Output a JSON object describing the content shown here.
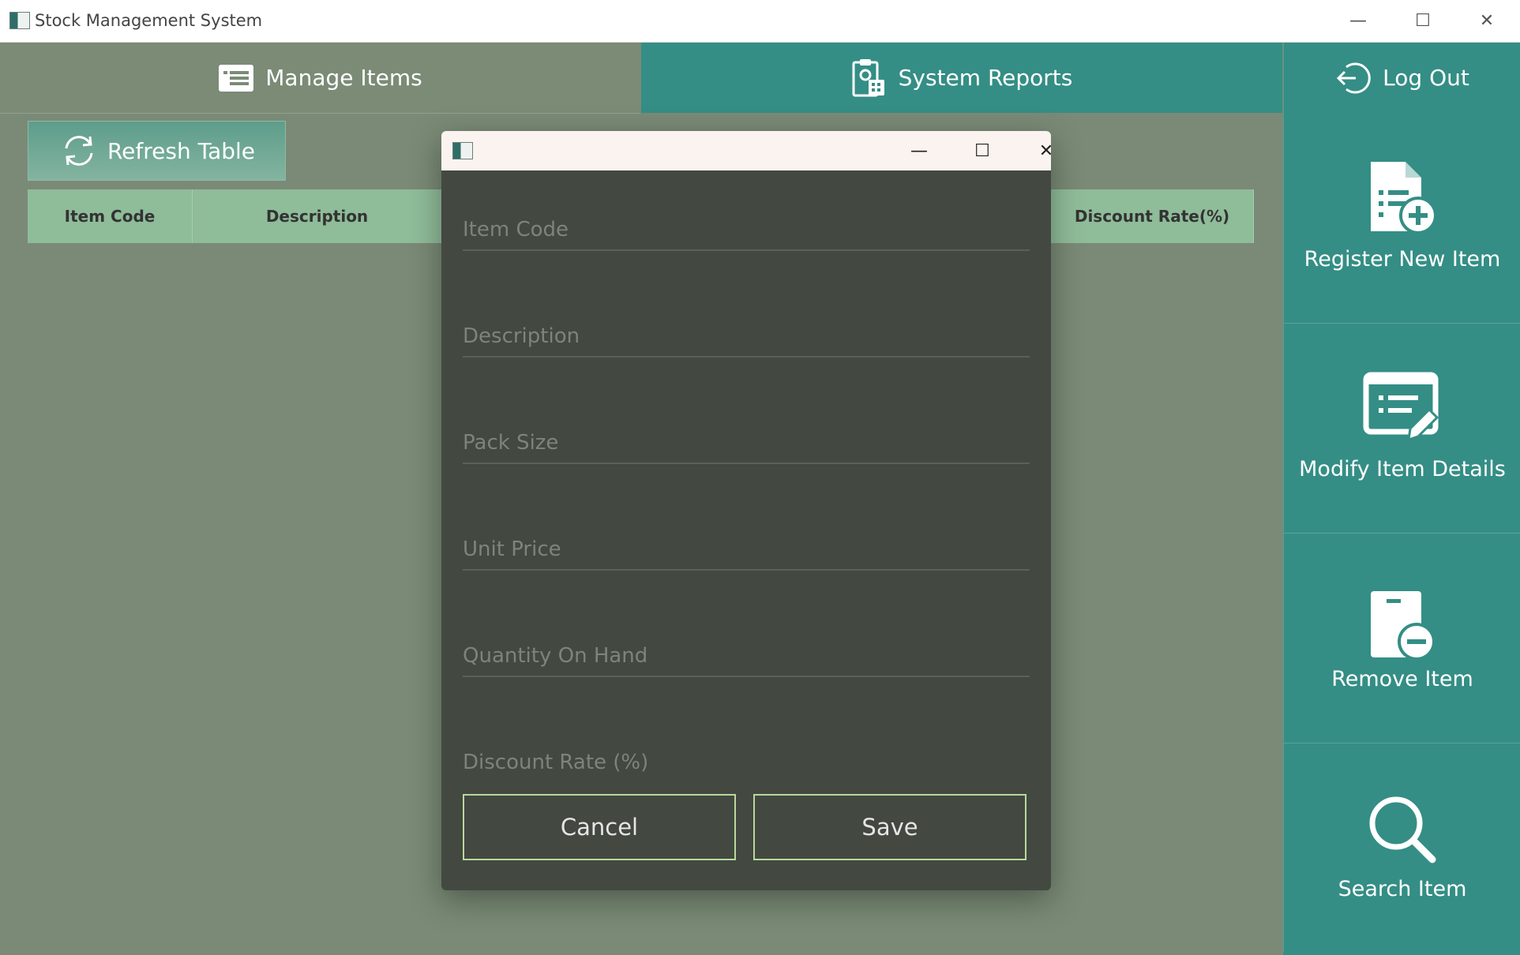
{
  "window": {
    "title": "Stock Management System",
    "minimize": "—",
    "maximize": "☐",
    "close": "✕"
  },
  "nav": {
    "manage_items": "Manage Items",
    "system_reports": "System Reports",
    "log_out": "Log Out"
  },
  "toolbar": {
    "refresh": "Refresh Table"
  },
  "table": {
    "columns": [
      "Item Code",
      "Description",
      "Discount Rate(%)"
    ]
  },
  "side": {
    "register": "Register New Item",
    "modify": "Modify Item Details",
    "remove": "Remove Item",
    "search": "Search Item"
  },
  "dialog": {
    "minimize": "—",
    "maximize": "☐",
    "close": "✕",
    "fields": {
      "item_code": "Item Code",
      "description": "Description",
      "pack_size": "Pack Size",
      "unit_price": "Unit Price",
      "quantity": "Quantity On Hand",
      "discount": "Discount Rate (%)"
    },
    "cancel": "Cancel",
    "save": "Save"
  },
  "colors": {
    "accent": "#348e85",
    "background": "#7a8a76",
    "dialog": "#434841",
    "button_border": "#b9d99a"
  }
}
